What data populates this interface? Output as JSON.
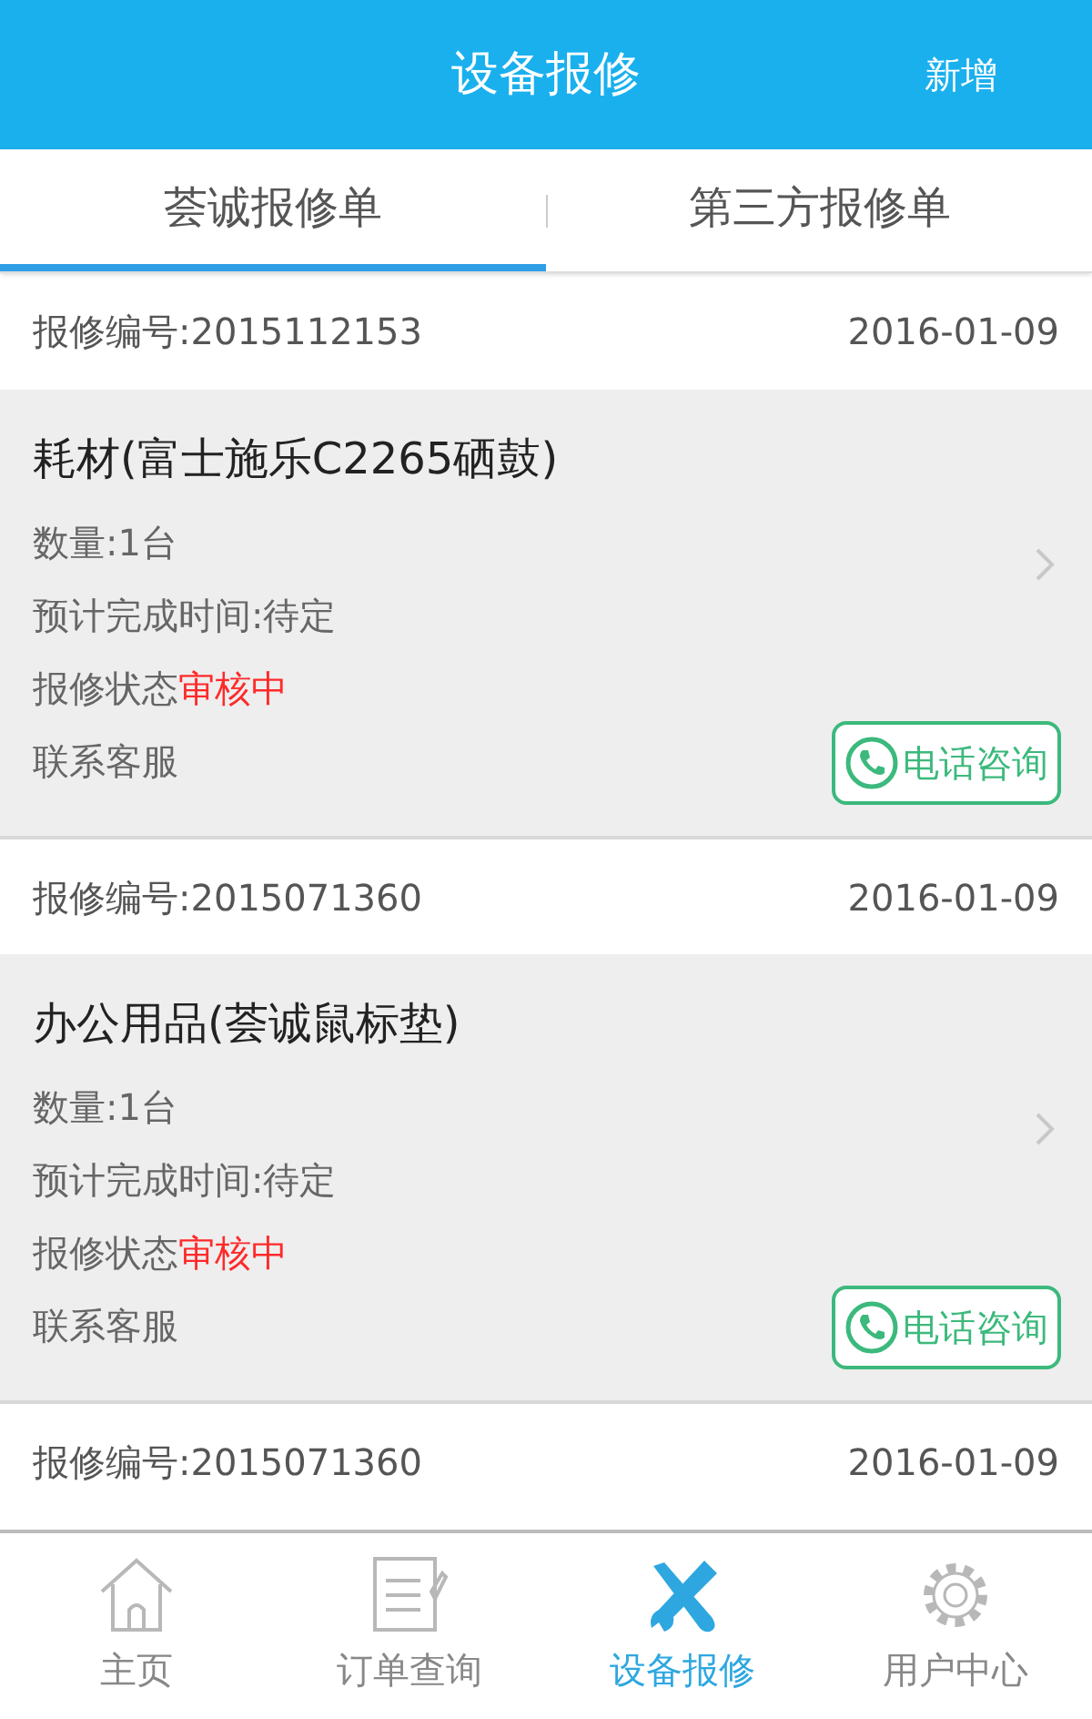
{
  "header": {
    "title": "设备报修",
    "action": "新增"
  },
  "tabs": [
    {
      "label": "荟诚报修单",
      "selected": true
    },
    {
      "label": "第三方报修单",
      "selected": false
    }
  ],
  "orders": [
    {
      "number": "报修编号:2015112153",
      "date": "2016-01-09",
      "item": "耗材(富士施乐C2265硒鼓)",
      "quantity": "数量:1台",
      "eta": "预计完成时间:待定",
      "status_label": "报修状态",
      "status": "审核中",
      "contact": "联系客服",
      "call_button": "电话咨询"
    },
    {
      "number": "报修编号:2015071360",
      "date": "2016-01-09",
      "item": "办公用品(荟诚鼠标垫)",
      "quantity": "数量:1台",
      "eta": "预计完成时间:待定",
      "status_label": "报修状态",
      "status": "审核中",
      "contact": "联系客服",
      "call_button": "电话咨询"
    },
    {
      "number": "报修编号:2015071360",
      "date": "2016-01-09"
    }
  ],
  "bottom_nav": [
    {
      "label": "主页",
      "kind": "home",
      "selected": false
    },
    {
      "label": "订单查询",
      "kind": "orders",
      "selected": false
    },
    {
      "label": "设备报修",
      "kind": "repair",
      "selected": true
    },
    {
      "label": "用户中心",
      "kind": "settings",
      "selected": false
    }
  ]
}
